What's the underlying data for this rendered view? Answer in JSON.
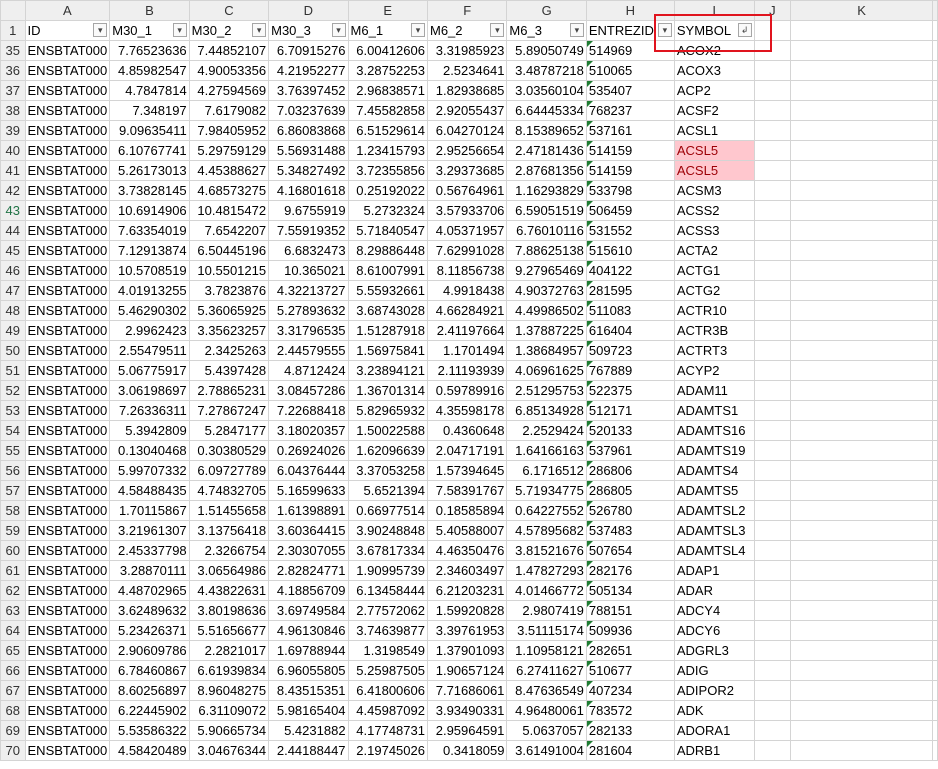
{
  "columns": [
    "A",
    "B",
    "C",
    "D",
    "E",
    "F",
    "G",
    "H",
    "I",
    "J",
    "K"
  ],
  "headers": [
    "ID",
    "M30_1",
    "M30_2",
    "M30_3",
    "M6_1",
    "M6_2",
    "M6_3",
    "ENTREZID",
    "SYMBOL"
  ],
  "header_row_number": "1",
  "filter_glyph": "▾",
  "sort_filter_glyph": "↲",
  "highlight_color": "#ffc7ce",
  "rows": [
    {
      "n": "35",
      "id": "ENSBTAT000",
      "v": [
        "7.76523636",
        "7.44852107",
        "6.70915276",
        "6.00412606",
        "3.31985923",
        "5.89050749"
      ],
      "entrez": "514969",
      "symbol": "ACOX2"
    },
    {
      "n": "36",
      "id": "ENSBTAT000",
      "v": [
        "4.85982547",
        "4.90053356",
        "4.21952277",
        "3.28752253",
        "2.5234641",
        "3.48787218"
      ],
      "entrez": "510065",
      "symbol": "ACOX3"
    },
    {
      "n": "37",
      "id": "ENSBTAT000",
      "v": [
        "4.7847814",
        "4.27594569",
        "3.76397452",
        "2.96838571",
        "1.82938685",
        "3.03560104"
      ],
      "entrez": "535407",
      "symbol": "ACP2"
    },
    {
      "n": "38",
      "id": "ENSBTAT000",
      "v": [
        "7.348197",
        "7.6179082",
        "7.03237639",
        "7.45582858",
        "2.92055437",
        "6.64445334"
      ],
      "entrez": "768237",
      "symbol": "ACSF2"
    },
    {
      "n": "39",
      "id": "ENSBTAT000",
      "v": [
        "9.09635411",
        "7.98405952",
        "6.86083868",
        "6.51529614",
        "6.04270124",
        "8.15389652"
      ],
      "entrez": "537161",
      "symbol": "ACSL1"
    },
    {
      "n": "40",
      "id": "ENSBTAT000",
      "v": [
        "6.10767741",
        "5.29759129",
        "5.56931488",
        "1.23415793",
        "2.95256654",
        "2.47181436"
      ],
      "entrez": "514159",
      "symbol": "ACSL5",
      "hl": true
    },
    {
      "n": "41",
      "id": "ENSBTAT000",
      "v": [
        "5.26173013",
        "4.45388627",
        "5.34827492",
        "3.72355856",
        "3.29373685",
        "2.87681356"
      ],
      "entrez": "514159",
      "symbol": "ACSL5",
      "hl": true
    },
    {
      "n": "42",
      "id": "ENSBTAT000",
      "v": [
        "3.73828145",
        "4.68573275",
        "4.16801618",
        "0.25192022",
        "0.56764961",
        "1.16293829"
      ],
      "entrez": "533798",
      "symbol": "ACSM3"
    },
    {
      "n": "43",
      "id": "ENSBTAT000",
      "v": [
        "10.6914906",
        "10.4815472",
        "9.6755919",
        "5.2732324",
        "3.57933706",
        "6.59051519"
      ],
      "entrez": "506459",
      "symbol": "ACSS2",
      "sel": true
    },
    {
      "n": "44",
      "id": "ENSBTAT000",
      "v": [
        "7.63354019",
        "7.6542207",
        "7.55919352",
        "5.71840547",
        "4.05371957",
        "6.76010116"
      ],
      "entrez": "531552",
      "symbol": "ACSS3"
    },
    {
      "n": "45",
      "id": "ENSBTAT000",
      "v": [
        "7.12913874",
        "6.50445196",
        "6.6832473",
        "8.29886448",
        "7.62991028",
        "7.88625138"
      ],
      "entrez": "515610",
      "symbol": "ACTA2"
    },
    {
      "n": "46",
      "id": "ENSBTAT000",
      "v": [
        "10.5708519",
        "10.5501215",
        "10.365021",
        "8.61007991",
        "8.11856738",
        "9.27965469"
      ],
      "entrez": "404122",
      "symbol": "ACTG1"
    },
    {
      "n": "47",
      "id": "ENSBTAT000",
      "v": [
        "4.01913255",
        "3.7823876",
        "4.32213727",
        "5.55932661",
        "4.9918438",
        "4.90372763"
      ],
      "entrez": "281595",
      "symbol": "ACTG2"
    },
    {
      "n": "48",
      "id": "ENSBTAT000",
      "v": [
        "5.46290302",
        "5.36065925",
        "5.27893632",
        "3.68743028",
        "4.66284921",
        "4.49986502"
      ],
      "entrez": "511083",
      "symbol": "ACTR10"
    },
    {
      "n": "49",
      "id": "ENSBTAT000",
      "v": [
        "2.9962423",
        "3.35623257",
        "3.31796535",
        "1.51287918",
        "2.41197664",
        "1.37887225"
      ],
      "entrez": "616404",
      "symbol": "ACTR3B"
    },
    {
      "n": "50",
      "id": "ENSBTAT000",
      "v": [
        "2.55479511",
        "2.3425263",
        "2.44579555",
        "1.56975841",
        "1.1701494",
        "1.38684957"
      ],
      "entrez": "509723",
      "symbol": "ACTRT3"
    },
    {
      "n": "51",
      "id": "ENSBTAT000",
      "v": [
        "5.06775917",
        "5.4397428",
        "4.8712424",
        "3.23894121",
        "2.11193939",
        "4.06961625"
      ],
      "entrez": "767889",
      "symbol": "ACYP2"
    },
    {
      "n": "52",
      "id": "ENSBTAT000",
      "v": [
        "3.06198697",
        "2.78865231",
        "3.08457286",
        "1.36701314",
        "0.59789916",
        "2.51295753"
      ],
      "entrez": "522375",
      "symbol": "ADAM11"
    },
    {
      "n": "53",
      "id": "ENSBTAT000",
      "v": [
        "7.26336311",
        "7.27867247",
        "7.22688418",
        "5.82965932",
        "4.35598178",
        "6.85134928"
      ],
      "entrez": "512171",
      "symbol": "ADAMTS1"
    },
    {
      "n": "54",
      "id": "ENSBTAT000",
      "v": [
        "5.3942809",
        "5.2847177",
        "3.18020357",
        "1.50022588",
        "0.4360648",
        "2.2529424"
      ],
      "entrez": "520133",
      "symbol": "ADAMTS16"
    },
    {
      "n": "55",
      "id": "ENSBTAT000",
      "v": [
        "0.13040468",
        "0.30380529",
        "0.26924026",
        "1.62096639",
        "2.04717191",
        "1.64166163"
      ],
      "entrez": "537961",
      "symbol": "ADAMTS19"
    },
    {
      "n": "56",
      "id": "ENSBTAT000",
      "v": [
        "5.99707332",
        "6.09727789",
        "6.04376444",
        "3.37053258",
        "1.57394645",
        "6.1716512"
      ],
      "entrez": "286806",
      "symbol": "ADAMTS4"
    },
    {
      "n": "57",
      "id": "ENSBTAT000",
      "v": [
        "4.58488435",
        "4.74832705",
        "5.16599633",
        "5.6521394",
        "7.58391767",
        "5.71934775"
      ],
      "entrez": "286805",
      "symbol": "ADAMTS5"
    },
    {
      "n": "58",
      "id": "ENSBTAT000",
      "v": [
        "1.70115867",
        "1.51455658",
        "1.61398891",
        "0.66977514",
        "0.18585894",
        "0.64227552"
      ],
      "entrez": "526780",
      "symbol": "ADAMTSL2"
    },
    {
      "n": "59",
      "id": "ENSBTAT000",
      "v": [
        "3.21961307",
        "3.13756418",
        "3.60364415",
        "3.90248848",
        "5.40588007",
        "4.57895682"
      ],
      "entrez": "537483",
      "symbol": "ADAMTSL3"
    },
    {
      "n": "60",
      "id": "ENSBTAT000",
      "v": [
        "2.45337798",
        "2.3266754",
        "2.30307055",
        "3.67817334",
        "4.46350476",
        "3.81521676"
      ],
      "entrez": "507654",
      "symbol": "ADAMTSL4"
    },
    {
      "n": "61",
      "id": "ENSBTAT000",
      "v": [
        "3.28870111",
        "3.06564986",
        "2.82824771",
        "1.90995739",
        "2.34603497",
        "1.47827293"
      ],
      "entrez": "282176",
      "symbol": "ADAP1"
    },
    {
      "n": "62",
      "id": "ENSBTAT000",
      "v": [
        "4.48702965",
        "4.43822631",
        "4.18856709",
        "6.13458444",
        "6.21203231",
        "4.01466772"
      ],
      "entrez": "505134",
      "symbol": "ADAR"
    },
    {
      "n": "63",
      "id": "ENSBTAT000",
      "v": [
        "3.62489632",
        "3.80198636",
        "3.69749584",
        "2.77572062",
        "1.59920828",
        "2.9807419"
      ],
      "entrez": "788151",
      "symbol": "ADCY4"
    },
    {
      "n": "64",
      "id": "ENSBTAT000",
      "v": [
        "5.23426371",
        "5.51656677",
        "4.96130846",
        "3.74639877",
        "3.39761953",
        "3.51115174"
      ],
      "entrez": "509936",
      "symbol": "ADCY6"
    },
    {
      "n": "65",
      "id": "ENSBTAT000",
      "v": [
        "2.90609786",
        "2.2821017",
        "1.69788944",
        "1.3198549",
        "1.37901093",
        "1.10958121"
      ],
      "entrez": "282651",
      "symbol": "ADGRL3"
    },
    {
      "n": "66",
      "id": "ENSBTAT000",
      "v": [
        "6.78460867",
        "6.61939834",
        "6.96055805",
        "5.25987505",
        "1.90657124",
        "6.27411627"
      ],
      "entrez": "510677",
      "symbol": "ADIG"
    },
    {
      "n": "67",
      "id": "ENSBTAT000",
      "v": [
        "8.60256897",
        "8.96048275",
        "8.43515351",
        "6.41800606",
        "7.71686061",
        "8.47636549"
      ],
      "entrez": "407234",
      "symbol": "ADIPOR2"
    },
    {
      "n": "68",
      "id": "ENSBTAT000",
      "v": [
        "6.22445902",
        "6.31109072",
        "5.98165404",
        "4.45987092",
        "3.93490331",
        "4.96480061"
      ],
      "entrez": "783572",
      "symbol": "ADK"
    },
    {
      "n": "69",
      "id": "ENSBTAT000",
      "v": [
        "5.53586322",
        "5.90665734",
        "5.4231882",
        "4.17748731",
        "2.95964591",
        "5.0637057"
      ],
      "entrez": "282133",
      "symbol": "ADORA1"
    },
    {
      "n": "70",
      "id": "ENSBTAT000",
      "v": [
        "4.58420489",
        "3.04676344",
        "2.44188447",
        "2.19745026",
        "0.3418059",
        "3.61491004"
      ],
      "entrez": "281604",
      "symbol": "ADRB1"
    }
  ]
}
